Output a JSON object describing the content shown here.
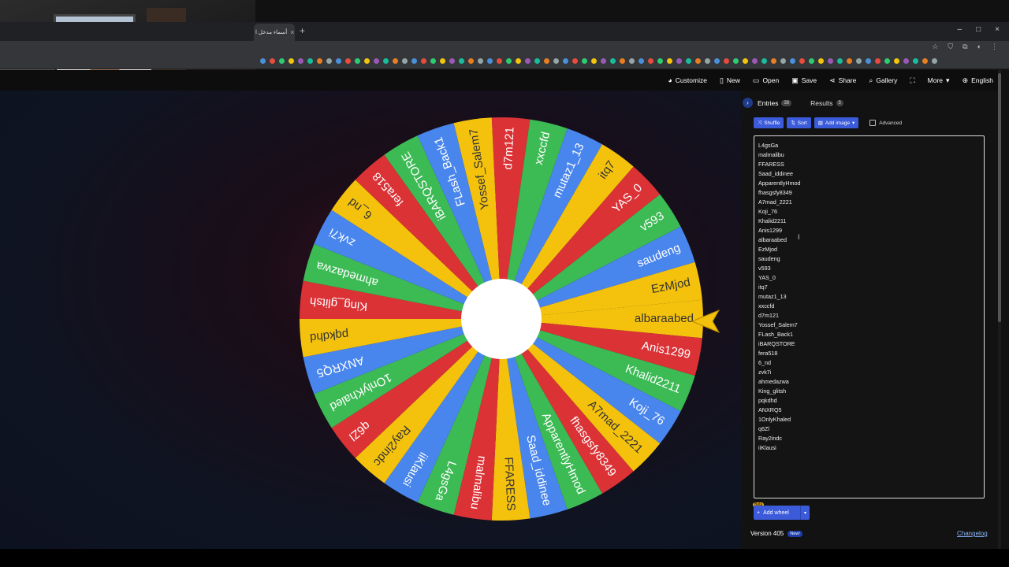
{
  "browser": {
    "tab_title": "أسماء مدخل ا",
    "tab_close": "×",
    "new_tab": "+",
    "window_controls": [
      "–",
      "□",
      "×"
    ]
  },
  "toolbar": {
    "customize": "Customize",
    "new": "New",
    "open": "Open",
    "save": "Save",
    "share": "Share",
    "gallery": "Gallery",
    "fullscreen": "⛶",
    "more": "More",
    "language": "English"
  },
  "tabs": {
    "entries_label": "Entries",
    "entries_count": "38",
    "results_label": "Results",
    "results_count": "5"
  },
  "actions": {
    "shuffle": "Shuffle",
    "sort": "Sort",
    "add_image": "Add image",
    "advanced": "Advanced"
  },
  "entries": [
    "L4gsGa",
    "malmalibu",
    "FFARESS",
    "Saad_iddinee",
    "ApparentlyHmod",
    "fhasgsfy8349",
    "A7mad_2221",
    "Koji_76",
    "Khalid2211",
    "Anis1299",
    "albaraabed",
    "EzMjod",
    "saudeng",
    "v593",
    "YAS_0",
    "itq7",
    "mutaz1_13",
    "xxccfd",
    "d7m121",
    "Yossef_Salem7",
    "FLash_Back1",
    "iBARQSTORE",
    "fera518",
    "6_nd",
    "zvk7i",
    "ahmedazwa",
    "King_glitsh",
    "pqkdhd",
    "ANXRQ5",
    "1OnlyKhaled",
    "q6Zl",
    "Ray2indc",
    "iiKlausi"
  ],
  "wheel": {
    "labels": [
      "albaraabed",
      "Anis1299",
      "Khalid2211",
      "Koji_76",
      "A7mad_2221",
      "fhasgsfy8349",
      "ApparentlyHmod",
      "Saad_iddinee",
      "FFARESS",
      "malmalibu",
      "L4gsGa",
      "iiKlausi",
      "Ray2indc",
      "q6Zl",
      "1OnlyKhaled",
      "ANXRQ5",
      "pqkdhd",
      "King_glitsh",
      "ahmedazwa",
      "zvk7i",
      "6_nd",
      "fera518",
      "iBARQSTORE",
      "FLash_Back1",
      "Yossef_Salem7",
      "d7m121",
      "xxccfd",
      "mutaz1_13",
      "itq7",
      "YAS_0",
      "v593",
      "saudeng",
      "EzMjod"
    ],
    "colors": [
      "#f4c20d",
      "#db3236",
      "#3cba54",
      "#4885ed"
    ]
  },
  "footer": {
    "beta": "Beta",
    "add_wheel": "Add wheel",
    "version": "Version 405",
    "new_badge": "New!",
    "changelog": "Changelog"
  }
}
